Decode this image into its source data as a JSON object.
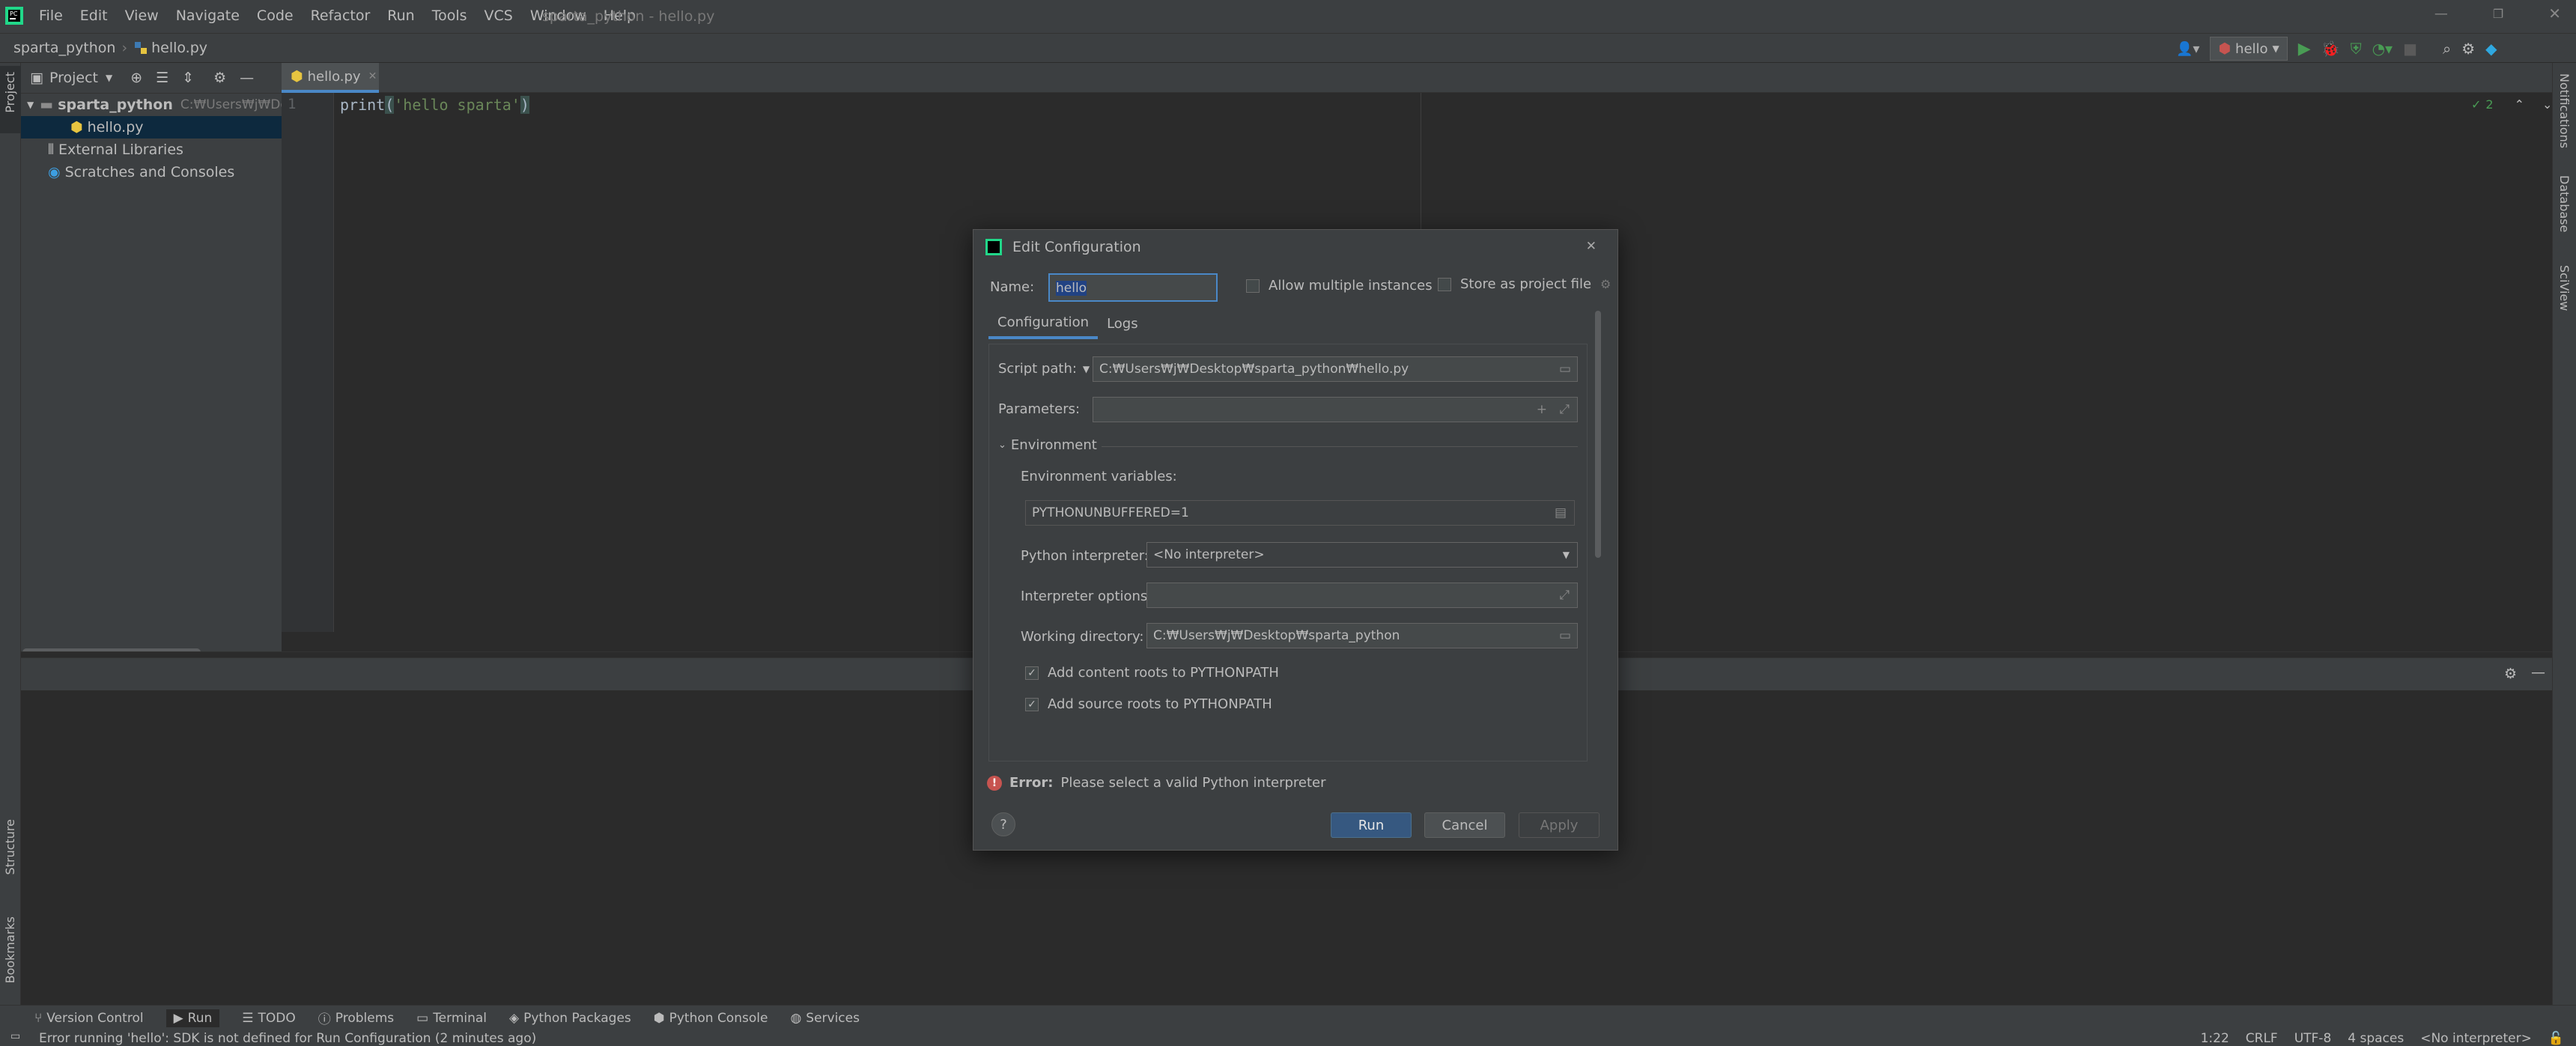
{
  "window": {
    "title": "sparta_python - hello.py",
    "menu": [
      "File",
      "Edit",
      "View",
      "Navigate",
      "Code",
      "Refactor",
      "Run",
      "Tools",
      "VCS",
      "Window",
      "Help"
    ]
  },
  "navbar": {
    "breadcrumb": [
      "sparta_python",
      "hello.py"
    ],
    "run_config": "hello"
  },
  "project_panel": {
    "title": "Project",
    "tree": [
      {
        "label": "sparta_python",
        "path": "C:₩Users₩j₩Deskt",
        "type": "folder"
      },
      {
        "label": "hello.py",
        "type": "file"
      },
      {
        "label": "External Libraries",
        "type": "libraries"
      },
      {
        "label": "Scratches and Consoles",
        "type": "scratches"
      }
    ]
  },
  "editor": {
    "tab": "hello.py",
    "line_number": "1",
    "code_prefix": "print",
    "code_paren_open": "(",
    "code_string": "'hello sparta'",
    "code_paren_close": ")",
    "inspection_count": "2"
  },
  "left_strip": {
    "project": "Project",
    "structure": "Structure",
    "bookmarks": "Bookmarks"
  },
  "right_strip": {
    "notifications": "Notifications",
    "database": "Database",
    "sciview": "SciView"
  },
  "dialog": {
    "title": "Edit Configuration",
    "name_label": "Name:",
    "name_value": "hello",
    "allow_multiple": "Allow multiple instances",
    "store_project": "Store as project file",
    "tabs": [
      "Configuration",
      "Logs"
    ],
    "script_path_label": "Script path:",
    "script_path_value": "C:₩Users₩j₩Desktop₩sparta_python₩hello.py",
    "parameters_label": "Parameters:",
    "environment_section": "Environment",
    "env_vars_label": "Environment variables:",
    "env_vars_value": "PYTHONUNBUFFERED=1",
    "interpreter_label": "Python interpreter:",
    "interpreter_value": "<No interpreter>",
    "interp_options_label": "Interpreter options:",
    "working_dir_label": "Working directory:",
    "working_dir_value": "C:₩Users₩j₩Desktop₩sparta_python",
    "content_roots": "Add content roots to PYTHONPATH",
    "source_roots": "Add source roots to PYTHONPATH",
    "error_prefix": "Error:",
    "error_message": "Please select a valid Python interpreter",
    "run_button": "Run",
    "cancel_button": "Cancel",
    "apply_button": "Apply",
    "help_button": "?"
  },
  "tool_windows": [
    "Version Control",
    "Run",
    "TODO",
    "Problems",
    "Terminal",
    "Python Packages",
    "Python Console",
    "Services"
  ],
  "status": {
    "message": "Error running 'hello': SDK is not defined for Run Configuration (2 minutes ago)",
    "position": "1:22",
    "line_sep": "CRLF",
    "encoding": "UTF-8",
    "indent": "4 spaces",
    "interpreter": "<No interpreter>"
  },
  "colors": {
    "accent": "#4a88c7",
    "primary_button": "#365880",
    "error": "#c75450",
    "run_green": "#499c54"
  }
}
